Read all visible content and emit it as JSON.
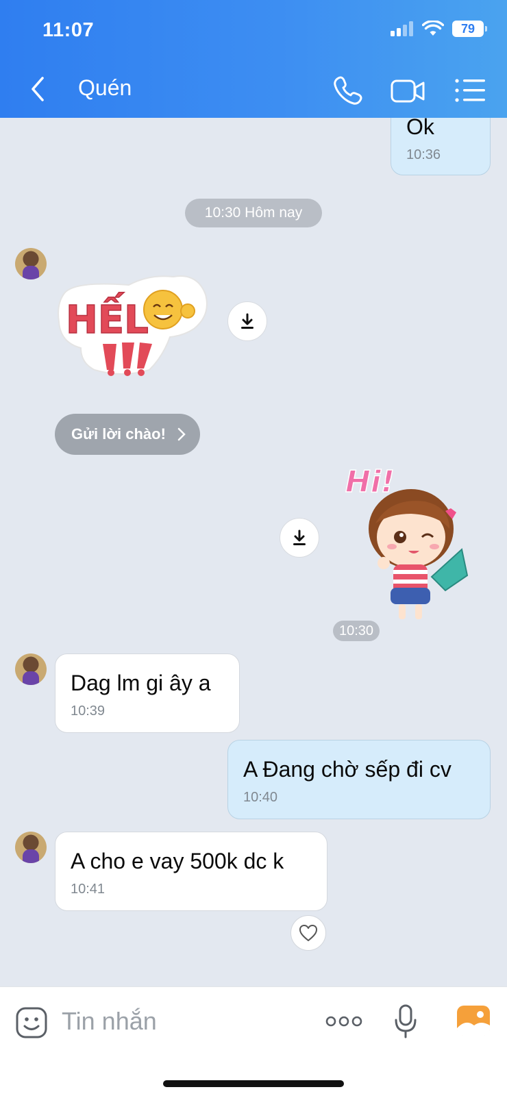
{
  "status_bar": {
    "time": "11:07",
    "battery": "79"
  },
  "header": {
    "title": "Quén"
  },
  "messages": [
    {
      "text": "Ok",
      "time": "10:36"
    },
    {
      "separator": "10:30 Hôm nay"
    },
    {
      "sticker": "hello-sticker",
      "sticker_text": "HẾL"
    },
    {
      "action": "Gửi lời chào!"
    },
    {
      "sticker": "hi-girl-sticker",
      "sticker_text": "Hi!"
    },
    {
      "time": "10:30"
    },
    {
      "text": "Dag lm gi ây a",
      "time": "10:39"
    },
    {
      "text": "A Đang chờ sếp đi cv",
      "time": "10:40"
    },
    {
      "text": "A cho e vay 500k dc k",
      "time": "10:41"
    }
  ],
  "input": {
    "placeholder": "Tin nhắn"
  },
  "colors": {
    "header_start": "#2f7ef0",
    "header_end": "#4aa3ef",
    "outgoing_bubble": "#d6ecfb",
    "incoming_bubble": "#ffffff",
    "chat_bg": "#e3e8f0",
    "gallery_icon": "#f5a03a"
  }
}
